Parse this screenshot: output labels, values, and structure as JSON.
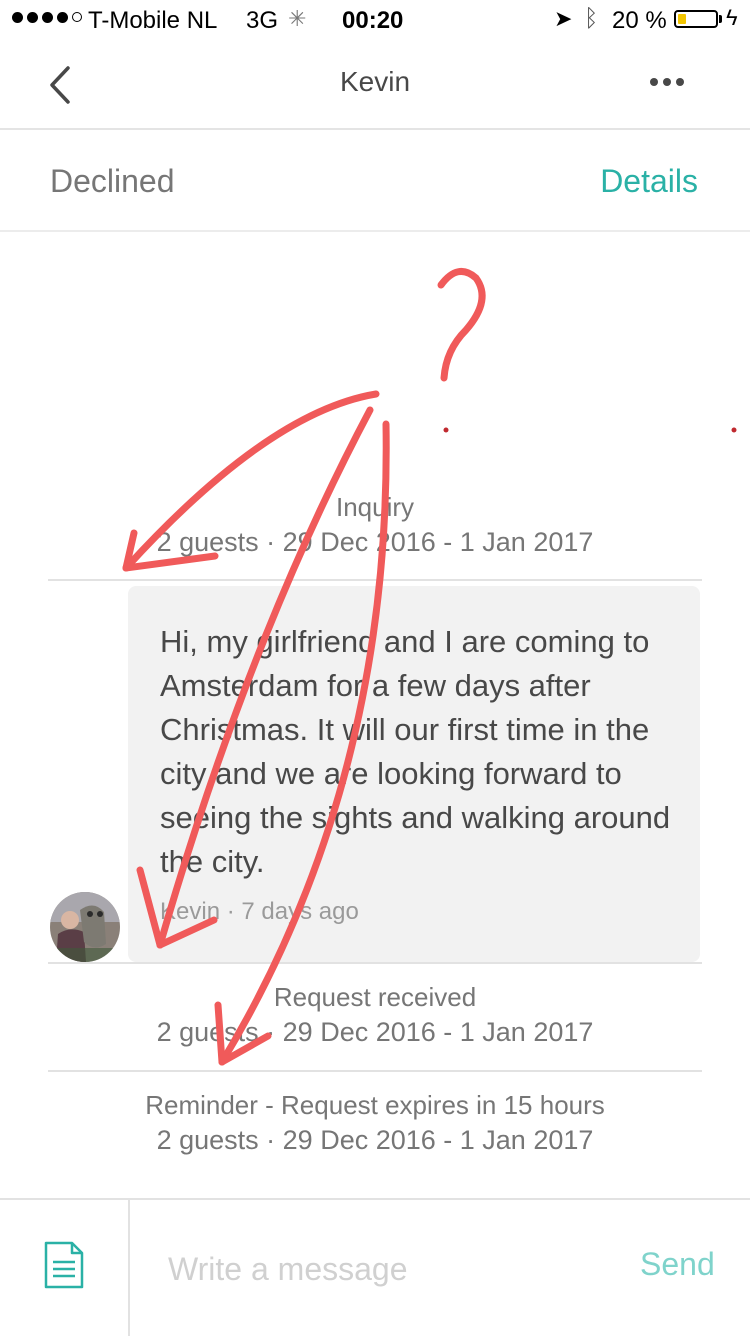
{
  "status_bar": {
    "carrier": "T-Mobile NL",
    "network": "3G",
    "time": "00:20",
    "battery": "20 %",
    "battery_level": 0.2,
    "signal_bars": 4,
    "signal_max": 5
  },
  "nav": {
    "title": "Kevin",
    "back_icon": "chevron-left-icon",
    "more_icon": "ellipsis-icon"
  },
  "reservation": {
    "status": "Declined",
    "details_link": "Details"
  },
  "events": {
    "inquiry": {
      "label": "Inquiry",
      "summary": "2 guests · 29 Dec 2016 - 1 Jan 2017"
    },
    "request_received": {
      "label": "Request received",
      "summary": "2 guests · 29 Dec 2016 - 1 Jan 2017"
    },
    "reminder": {
      "label": "Reminder - Request expires in 15 hours",
      "summary": "2 guests · 29 Dec 2016 - 1 Jan 2017"
    }
  },
  "message": {
    "text": "Hi, my girlfriend and I are coming to Amsterdam for a few days after Christmas. It will our first time in the city and we are looking forward to seeing the sights and walking around the city.",
    "meta": "Kevin · 7 days ago"
  },
  "composer": {
    "placeholder": "Write a message",
    "send_label": "Send",
    "template_icon": "document-icon"
  },
  "annotation": {
    "mark": "?",
    "color": "#f05a5a"
  },
  "colors": {
    "accent": "#2ab1a6",
    "send_disabled": "#7fd3cb",
    "bubble_bg": "#f2f2f2"
  }
}
